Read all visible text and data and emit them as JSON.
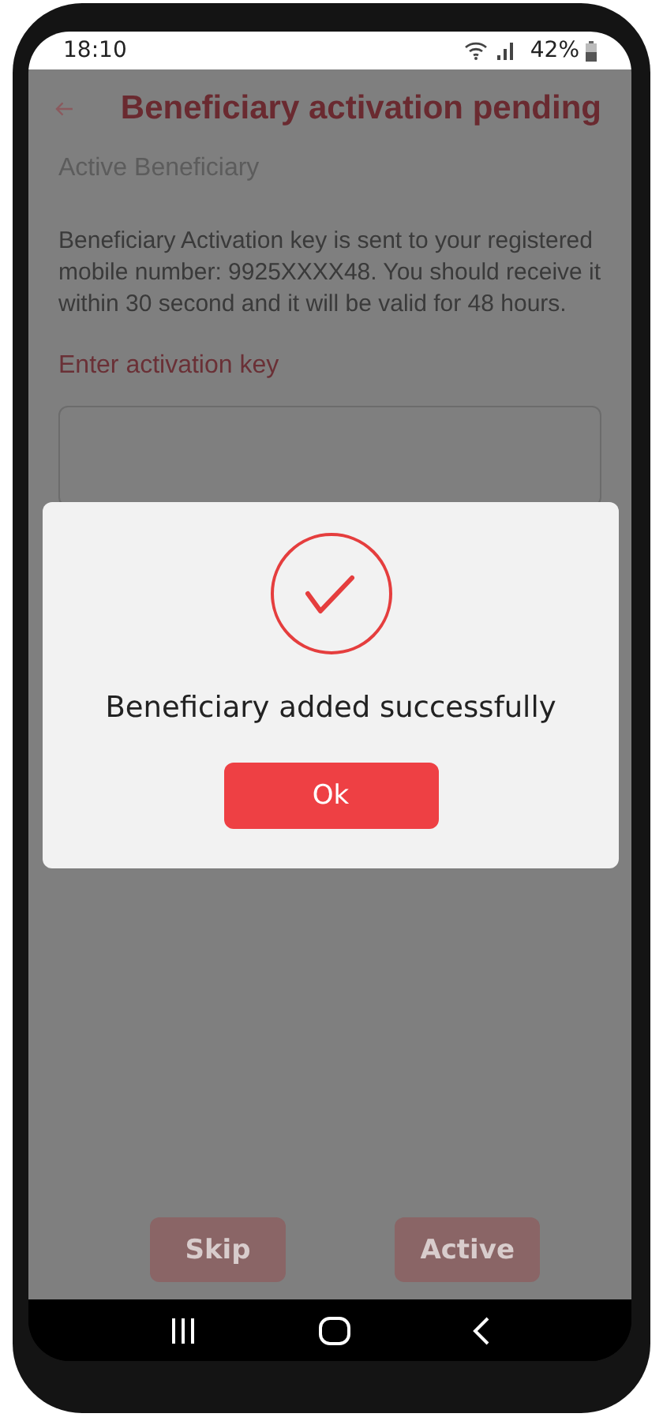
{
  "status_bar": {
    "time": "18:10",
    "battery": "42%"
  },
  "header": {
    "title": "Beneficiary activation pending"
  },
  "section_title": "Active Beneficiary",
  "message": "Beneficiary Activation key is sent to your registered mobile number: 9925XXXX48. You should receive it within 30 second and it will be valid for 48 hours.",
  "activation_key": {
    "label": "Enter activation key"
  },
  "buttons": [
    "Skip",
    "Active"
  ],
  "dialog": {
    "message": "Beneficiary added successfully",
    "button": "Ok"
  }
}
